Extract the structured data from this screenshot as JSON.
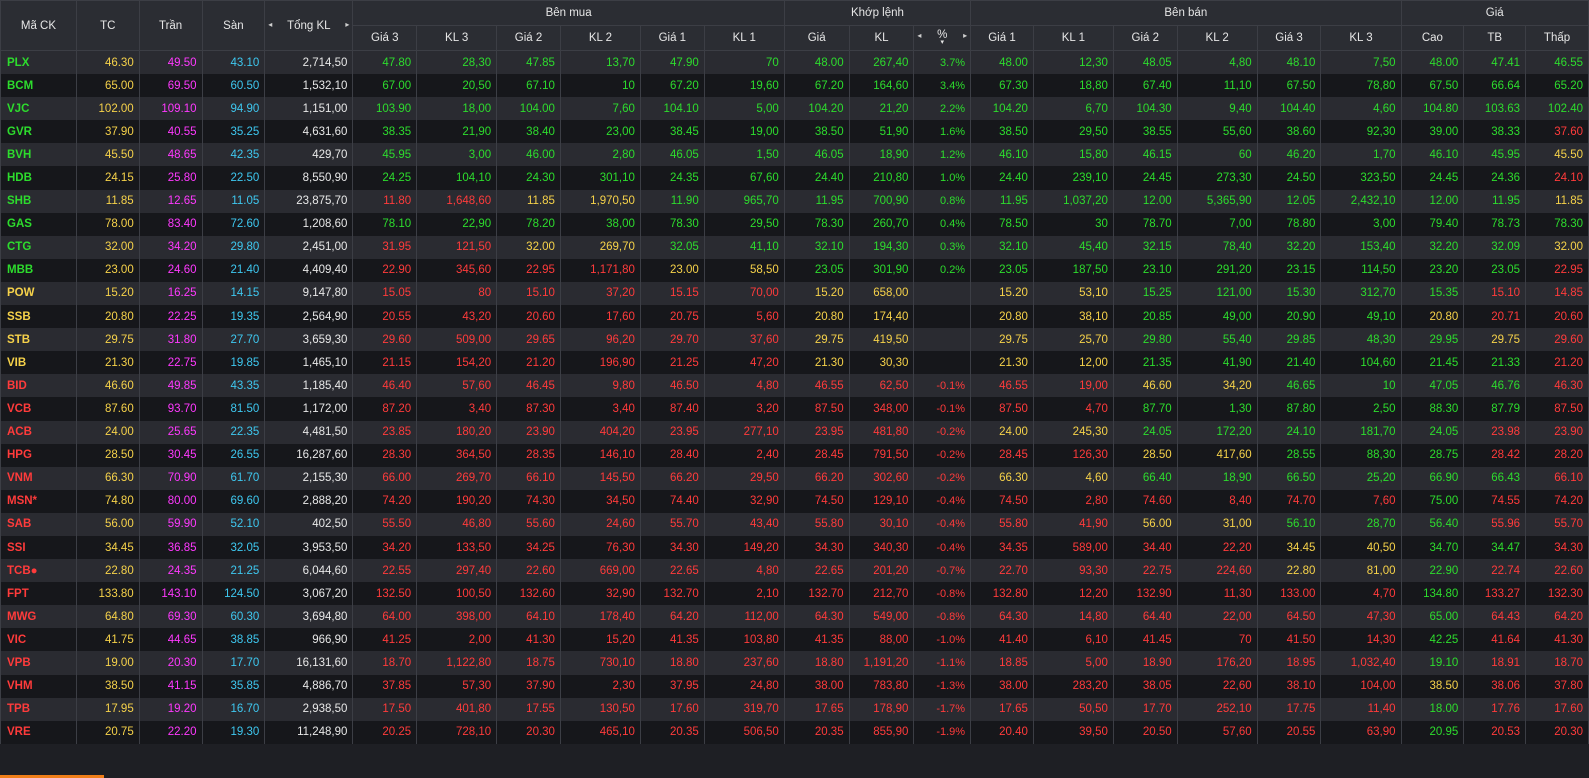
{
  "colors": {
    "up": "#2ddc2d",
    "down": "#ff3b3b",
    "ref": "#f6d24a",
    "ceil": "#ff39ff",
    "floor": "#3ec8f0",
    "neutral": "#e8e8e8",
    "scroll_accent": "#f07e19"
  },
  "headers": {
    "symbol": "Mã CK",
    "tc": "TC",
    "tran": "Trần",
    "san": "Sàn",
    "total": "Tổng KL",
    "buy_group": "Bên mua",
    "match_group": "Khớp lệnh",
    "sell_group": "Bên bán",
    "price_group": "Giá",
    "buy": [
      "Giá 3",
      "KL 3",
      "Giá 2",
      "KL 2",
      "Giá 1",
      "KL 1"
    ],
    "match": [
      "Giá",
      "KL",
      "%"
    ],
    "sell": [
      "Giá 1",
      "KL 1",
      "Giá 2",
      "KL 2",
      "Giá 3",
      "KL 3"
    ],
    "price": [
      "Cao",
      "TB",
      "Thấp"
    ],
    "arrow_left": "◂",
    "arrow_right": "▸",
    "sort_caret": "▾"
  },
  "rows": [
    [
      "PLX",
      "46.30",
      "49.50",
      "43.10",
      "2,714,50",
      "47.80",
      "28,30",
      "47.85",
      "13,70",
      "47.90",
      "70",
      "48.00",
      "267,40",
      "3.7%",
      "48.00",
      "12,30",
      "48.05",
      "4,80",
      "48.10",
      "7,50",
      "48.00",
      "47.41",
      "46.55"
    ],
    [
      "BCM",
      "65.00",
      "69.50",
      "60.50",
      "1,532,10",
      "67.00",
      "20,50",
      "67.10",
      "10",
      "67.20",
      "19,60",
      "67.20",
      "164,60",
      "3.4%",
      "67.30",
      "18,80",
      "67.40",
      "11,10",
      "67.50",
      "78,80",
      "67.50",
      "66.64",
      "65.20"
    ],
    [
      "VJC",
      "102.00",
      "109.10",
      "94.90",
      "1,151,00",
      "103.90",
      "18,00",
      "104.00",
      "7,60",
      "104.10",
      "5,00",
      "104.20",
      "21,20",
      "2.2%",
      "104.20",
      "6,70",
      "104.30",
      "9,40",
      "104.40",
      "4,60",
      "104.80",
      "103.63",
      "102.40"
    ],
    [
      "GVR",
      "37.90",
      "40.55",
      "35.25",
      "4,631,60",
      "38.35",
      "21,90",
      "38.40",
      "23,00",
      "38.45",
      "19,00",
      "38.50",
      "51,90",
      "1.6%",
      "38.50",
      "29,50",
      "38.55",
      "55,60",
      "38.60",
      "92,30",
      "39.00",
      "38.33",
      "37.60"
    ],
    [
      "BVH",
      "45.50",
      "48.65",
      "42.35",
      "429,70",
      "45.95",
      "3,00",
      "46.00",
      "2,80",
      "46.05",
      "1,50",
      "46.05",
      "18,90",
      "1.2%",
      "46.10",
      "15,80",
      "46.15",
      "60",
      "46.20",
      "1,70",
      "46.10",
      "45.95",
      "45.50"
    ],
    [
      "HDB",
      "24.15",
      "25.80",
      "22.50",
      "8,550,90",
      "24.25",
      "104,10",
      "24.30",
      "301,10",
      "24.35",
      "67,60",
      "24.40",
      "210,80",
      "1.0%",
      "24.40",
      "239,10",
      "24.45",
      "273,30",
      "24.50",
      "323,50",
      "24.45",
      "24.36",
      "24.10"
    ],
    [
      "SHB",
      "11.85",
      "12.65",
      "11.05",
      "23,875,70",
      "11.80",
      "1,648,60",
      "11.85",
      "1,970,50",
      "11.90",
      "965,70",
      "11.95",
      "700,90",
      "0.8%",
      "11.95",
      "1,037,20",
      "12.00",
      "5,365,90",
      "12.05",
      "2,432,10",
      "12.00",
      "11.95",
      "11.85"
    ],
    [
      "GAS",
      "78.00",
      "83.40",
      "72.60",
      "1,208,60",
      "78.10",
      "22,90",
      "78.20",
      "38,00",
      "78.30",
      "29,50",
      "78.30",
      "260,70",
      "0.4%",
      "78.50",
      "30",
      "78.70",
      "7,00",
      "78.80",
      "3,00",
      "79.40",
      "78.73",
      "78.30"
    ],
    [
      "CTG",
      "32.00",
      "34.20",
      "29.80",
      "2,451,00",
      "31.95",
      "121,50",
      "32.00",
      "269,70",
      "32.05",
      "41,10",
      "32.10",
      "194,30",
      "0.3%",
      "32.10",
      "45,40",
      "32.15",
      "78,40",
      "32.20",
      "153,40",
      "32.20",
      "32.09",
      "32.00"
    ],
    [
      "MBB",
      "23.00",
      "24.60",
      "21.40",
      "4,409,40",
      "22.90",
      "345,60",
      "22.95",
      "1,171,80",
      "23.00",
      "58,50",
      "23.05",
      "301,90",
      "0.2%",
      "23.05",
      "187,50",
      "23.10",
      "291,20",
      "23.15",
      "114,50",
      "23.20",
      "23.05",
      "22.95"
    ],
    [
      "POW",
      "15.20",
      "16.25",
      "14.15",
      "9,147,80",
      "15.05",
      "80",
      "15.10",
      "37,20",
      "15.15",
      "70,00",
      "15.20",
      "658,00",
      "",
      "15.20",
      "53,10",
      "15.25",
      "121,00",
      "15.30",
      "312,70",
      "15.35",
      "15.10",
      "14.85"
    ],
    [
      "SSB",
      "20.80",
      "22.25",
      "19.35",
      "2,564,90",
      "20.55",
      "43,20",
      "20.60",
      "17,60",
      "20.75",
      "5,60",
      "20.80",
      "174,40",
      "",
      "20.80",
      "38,10",
      "20.85",
      "49,00",
      "20.90",
      "49,10",
      "20.80",
      "20.71",
      "20.60"
    ],
    [
      "STB",
      "29.75",
      "31.80",
      "27.70",
      "3,659,30",
      "29.60",
      "509,00",
      "29.65",
      "96,20",
      "29.70",
      "37,60",
      "29.75",
      "419,50",
      "",
      "29.75",
      "25,70",
      "29.80",
      "55,40",
      "29.85",
      "48,30",
      "29.95",
      "29.75",
      "29.60"
    ],
    [
      "VIB",
      "21.30",
      "22.75",
      "19.85",
      "1,465,10",
      "21.15",
      "154,20",
      "21.20",
      "196,90",
      "21.25",
      "47,20",
      "21.30",
      "30,30",
      "",
      "21.30",
      "12,00",
      "21.35",
      "41,90",
      "21.40",
      "104,60",
      "21.45",
      "21.33",
      "21.20"
    ],
    [
      "BID",
      "46.60",
      "49.85",
      "43.35",
      "1,185,40",
      "46.40",
      "57,60",
      "46.45",
      "9,80",
      "46.50",
      "4,80",
      "46.55",
      "62,50",
      "-0.1%",
      "46.55",
      "19,00",
      "46.60",
      "34,20",
      "46.65",
      "10",
      "47.05",
      "46.76",
      "46.30"
    ],
    [
      "VCB",
      "87.60",
      "93.70",
      "81.50",
      "1,172,00",
      "87.20",
      "3,40",
      "87.30",
      "3,40",
      "87.40",
      "3,20",
      "87.50",
      "348,00",
      "-0.1%",
      "87.50",
      "4,70",
      "87.70",
      "1,30",
      "87.80",
      "2,50",
      "88.30",
      "87.79",
      "87.50"
    ],
    [
      "ACB",
      "24.00",
      "25.65",
      "22.35",
      "4,481,50",
      "23.85",
      "180,20",
      "23.90",
      "404,20",
      "23.95",
      "277,10",
      "23.95",
      "481,80",
      "-0.2%",
      "24.00",
      "245,30",
      "24.05",
      "172,20",
      "24.10",
      "181,70",
      "24.05",
      "23.98",
      "23.90"
    ],
    [
      "HPG",
      "28.50",
      "30.45",
      "26.55",
      "16,287,60",
      "28.30",
      "364,50",
      "28.35",
      "146,10",
      "28.40",
      "2,40",
      "28.45",
      "791,50",
      "-0.2%",
      "28.45",
      "126,30",
      "28.50",
      "417,60",
      "28.55",
      "88,30",
      "28.75",
      "28.42",
      "28.20"
    ],
    [
      "VNM",
      "66.30",
      "70.90",
      "61.70",
      "2,155,30",
      "66.00",
      "269,70",
      "66.10",
      "145,50",
      "66.20",
      "29,50",
      "66.20",
      "302,60",
      "-0.2%",
      "66.30",
      "4,60",
      "66.40",
      "18,90",
      "66.50",
      "25,20",
      "66.90",
      "66.43",
      "66.10"
    ],
    [
      "MSN*",
      "74.80",
      "80.00",
      "69.60",
      "2,888,20",
      "74.20",
      "190,20",
      "74.30",
      "34,50",
      "74.40",
      "32,90",
      "74.50",
      "129,10",
      "-0.4%",
      "74.50",
      "2,80",
      "74.60",
      "8,40",
      "74.70",
      "7,60",
      "75.00",
      "74.55",
      "74.20"
    ],
    [
      "SAB",
      "56.00",
      "59.90",
      "52.10",
      "402,50",
      "55.50",
      "46,80",
      "55.60",
      "24,60",
      "55.70",
      "43,40",
      "55.80",
      "30,10",
      "-0.4%",
      "55.80",
      "41,90",
      "56.00",
      "31,00",
      "56.10",
      "28,70",
      "56.40",
      "55.96",
      "55.70"
    ],
    [
      "SSI",
      "34.45",
      "36.85",
      "32.05",
      "3,953,50",
      "34.20",
      "133,50",
      "34.25",
      "76,30",
      "34.30",
      "149,20",
      "34.30",
      "340,30",
      "-0.4%",
      "34.35",
      "589,00",
      "34.40",
      "22,20",
      "34.45",
      "40,50",
      "34.70",
      "34.47",
      "34.30"
    ],
    [
      "TCB●",
      "22.80",
      "24.35",
      "21.25",
      "6,044,60",
      "22.55",
      "297,40",
      "22.60",
      "669,00",
      "22.65",
      "4,80",
      "22.65",
      "201,20",
      "-0.7%",
      "22.70",
      "93,30",
      "22.75",
      "224,60",
      "22.80",
      "81,00",
      "22.90",
      "22.74",
      "22.60"
    ],
    [
      "FPT",
      "133.80",
      "143.10",
      "124.50",
      "3,067,20",
      "132.50",
      "100,50",
      "132.60",
      "32,90",
      "132.70",
      "2,10",
      "132.70",
      "212,70",
      "-0.8%",
      "132.80",
      "12,20",
      "132.90",
      "11,30",
      "133.00",
      "4,70",
      "134.80",
      "133.27",
      "132.30"
    ],
    [
      "MWG",
      "64.80",
      "69.30",
      "60.30",
      "3,694,80",
      "64.00",
      "398,00",
      "64.10",
      "178,40",
      "64.20",
      "112,00",
      "64.30",
      "549,00",
      "-0.8%",
      "64.30",
      "14,80",
      "64.40",
      "22,00",
      "64.50",
      "47,30",
      "65.00",
      "64.43",
      "64.20"
    ],
    [
      "VIC",
      "41.75",
      "44.65",
      "38.85",
      "966,90",
      "41.25",
      "2,00",
      "41.30",
      "15,20",
      "41.35",
      "103,80",
      "41.35",
      "88,00",
      "-1.0%",
      "41.40",
      "6,10",
      "41.45",
      "70",
      "41.50",
      "14,30",
      "42.25",
      "41.64",
      "41.30"
    ],
    [
      "VPB",
      "19.00",
      "20.30",
      "17.70",
      "16,131,60",
      "18.70",
      "1,122,80",
      "18.75",
      "730,10",
      "18.80",
      "237,60",
      "18.80",
      "1,191,20",
      "-1.1%",
      "18.85",
      "5,00",
      "18.90",
      "176,20",
      "18.95",
      "1,032,40",
      "19.10",
      "18.91",
      "18.70"
    ],
    [
      "VHM",
      "38.50",
      "41.15",
      "35.85",
      "4,886,70",
      "37.85",
      "57,30",
      "37.90",
      "2,30",
      "37.95",
      "24,80",
      "38.00",
      "783,80",
      "-1.3%",
      "38.00",
      "283,20",
      "38.05",
      "22,60",
      "38.10",
      "104,00",
      "38.50",
      "38.06",
      "37.80"
    ],
    [
      "TPB",
      "17.95",
      "19.20",
      "16.70",
      "2,938,50",
      "17.50",
      "401,80",
      "17.55",
      "130,50",
      "17.60",
      "319,70",
      "17.65",
      "178,90",
      "-1.7%",
      "17.65",
      "50,50",
      "17.70",
      "252,10",
      "17.75",
      "11,40",
      "18.00",
      "17.76",
      "17.60"
    ],
    [
      "VRE",
      "20.75",
      "22.20",
      "19.30",
      "11,248,90",
      "20.25",
      "728,10",
      "20.30",
      "465,10",
      "20.35",
      "506,50",
      "20.35",
      "855,90",
      "-1.9%",
      "20.40",
      "39,50",
      "20.50",
      "57,60",
      "20.55",
      "63,90",
      "20.95",
      "20.53",
      "20.30"
    ]
  ]
}
